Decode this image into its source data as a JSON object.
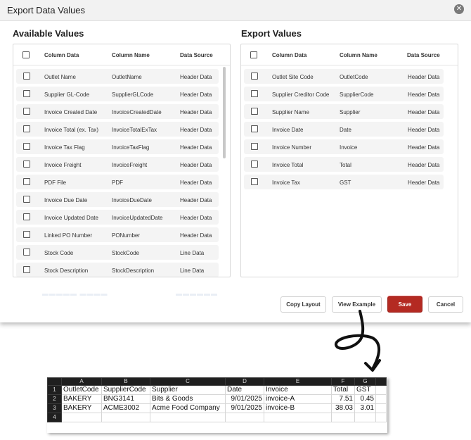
{
  "dialog": {
    "title": "Export Data Values",
    "close_icon": "close-icon",
    "available": {
      "heading": "Available Values",
      "columns": [
        "Column Data",
        "Column Name",
        "Data Source"
      ],
      "rows": [
        [
          "Outlet Name",
          "OutletName",
          "Header Data"
        ],
        [
          "Supplier GL-Code",
          "SupplierGLCode",
          "Header Data"
        ],
        [
          "Invoice Created Date",
          "InvoiceCreatedDate",
          "Header Data"
        ],
        [
          "Invoice Total (ex. Tax)",
          "InvoiceTotalExTax",
          "Header Data"
        ],
        [
          "Invoice Tax Flag",
          "InvoiceTaxFlag",
          "Header Data"
        ],
        [
          "Invoice Freight",
          "InvoiceFreight",
          "Header Data"
        ],
        [
          "PDF File",
          "PDF",
          "Header Data"
        ],
        [
          "Invoice Due Date",
          "InvoiceDueDate",
          "Header Data"
        ],
        [
          "Invoice Updated Date",
          "InvoiceUpdatedDate",
          "Header Data"
        ],
        [
          "Linked PO Number",
          "PONumber",
          "Header Data"
        ],
        [
          "Stock Code",
          "StockCode",
          "Line Data"
        ],
        [
          "Stock Description",
          "StockDescription",
          "Line Data"
        ]
      ]
    },
    "export": {
      "heading": "Export Values",
      "columns": [
        "Column Data",
        "Column Name",
        "Data Source"
      ],
      "rows": [
        [
          "Outlet Site Code",
          "OutletCode",
          "Header Data"
        ],
        [
          "Supplier Creditor Code",
          "SupplierCode",
          "Header Data"
        ],
        [
          "Supplier Name",
          "Supplier",
          "Header Data"
        ],
        [
          "Invoice Date",
          "Date",
          "Header Data"
        ],
        [
          "Invoice Number",
          "Invoice",
          "Header Data"
        ],
        [
          "Invoice Total",
          "Total",
          "Header Data"
        ],
        [
          "Invoice Tax",
          "GST",
          "Header Data"
        ]
      ]
    },
    "buttons": {
      "copy_layout": "Copy Layout",
      "view_example": "View Example",
      "save": "Save",
      "cancel": "Cancel"
    },
    "accent_color": "#b42a22"
  },
  "spreadsheet": {
    "column_letters": [
      "A",
      "B",
      "C",
      "D",
      "E",
      "F",
      "G"
    ],
    "row_numbers": [
      "1",
      "2",
      "3",
      "4"
    ],
    "rows": [
      [
        "OutletCode",
        "SupplierCode",
        "Supplier",
        "Date",
        "Invoice",
        "Total",
        "GST"
      ],
      [
        "BAKERY",
        "BNG3141",
        "Bits & Goods",
        "9/01/2025",
        "invoice-A",
        "7.51",
        "0.45"
      ],
      [
        "BAKERY",
        "ACME3002",
        "Acme Food Company",
        "9/01/2025",
        "invoice-B",
        "38.03",
        "3.01"
      ],
      [
        "",
        "",
        "",
        "",
        "",
        "",
        ""
      ]
    ]
  }
}
